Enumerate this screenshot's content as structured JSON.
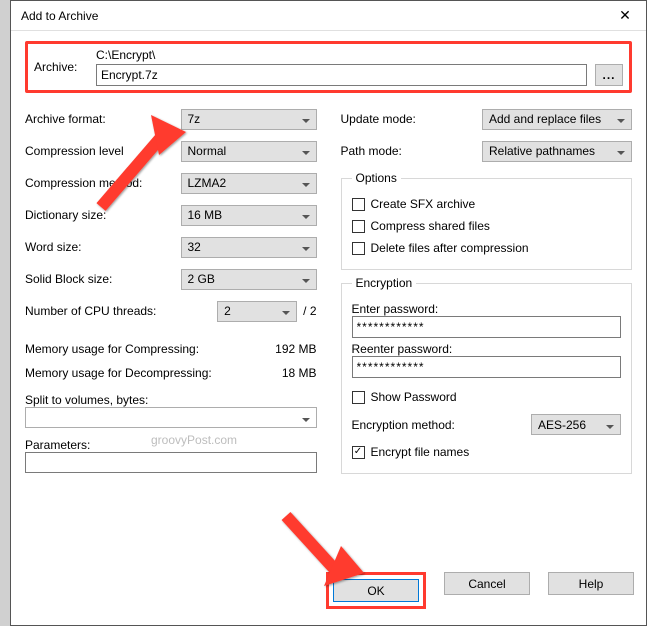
{
  "window": {
    "title": "Add to Archive",
    "close": "✕"
  },
  "archive": {
    "label": "Archive:",
    "path": "C:\\Encrypt\\",
    "filename": "Encrypt.7z",
    "browse": "..."
  },
  "left": {
    "format_label": "Archive format:",
    "format_value": "7z",
    "compression_level_label": "Compression level",
    "compression_level_value": "Normal",
    "compression_method_label": "Compression method:",
    "compression_method_value": "LZMA2",
    "dictionary_label": "Dictionary size:",
    "dictionary_value": "16 MB",
    "word_label": "Word size:",
    "word_value": "32",
    "solid_label": "Solid Block size:",
    "solid_value": "2 GB",
    "cpu_label": "Number of CPU threads:",
    "cpu_value": "2",
    "cpu_total": "/ 2",
    "mem_compress_label": "Memory usage for Compressing:",
    "mem_compress_value": "192 MB",
    "mem_decompress_label": "Memory usage for Decompressing:",
    "mem_decompress_value": "18 MB",
    "split_label": "Split to volumes, bytes:",
    "split_value": "",
    "parameters_label": "Parameters:",
    "parameters_value": ""
  },
  "right": {
    "update_label": "Update mode:",
    "update_value": "Add and replace files",
    "path_label": "Path mode:",
    "path_value": "Relative pathnames",
    "options": {
      "legend": "Options",
      "sfx": "Create SFX archive",
      "compress_shared": "Compress shared files",
      "delete_after": "Delete files after compression"
    },
    "encryption": {
      "legend": "Encryption",
      "enter_label": "Enter password:",
      "enter_value": "************",
      "reenter_label": "Reenter password:",
      "reenter_value": "************",
      "show_password": "Show Password",
      "method_label": "Encryption method:",
      "method_value": "AES-256",
      "encrypt_names": "Encrypt file names",
      "encrypt_names_checked": true
    }
  },
  "buttons": {
    "ok": "OK",
    "cancel": "Cancel",
    "help": "Help"
  },
  "watermark": "groovyPost.com"
}
